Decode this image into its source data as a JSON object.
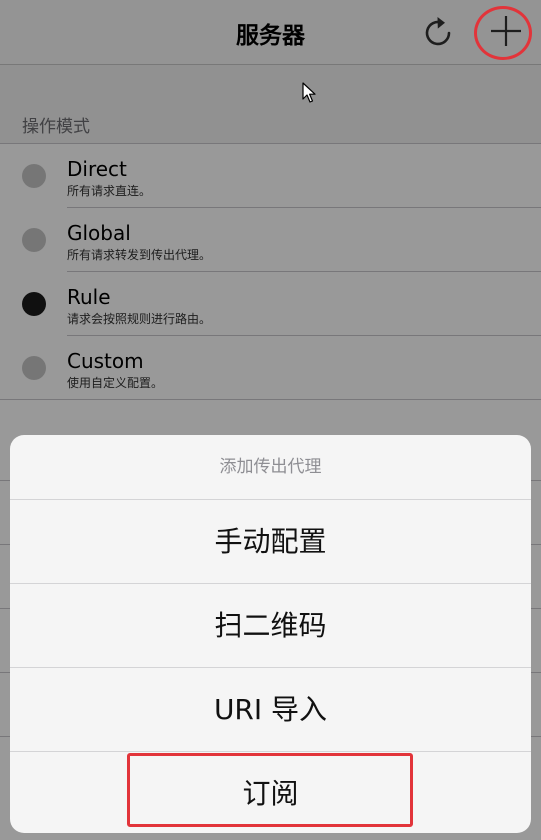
{
  "navbar": {
    "title": "服务器",
    "refresh_icon": "refresh-icon",
    "add_icon": "plus-icon"
  },
  "mode_section": {
    "header": "操作模式",
    "modes": [
      {
        "name": "Direct",
        "description": "所有请求直连。",
        "selected": false
      },
      {
        "name": "Global",
        "description": "所有请求转发到传出代理。",
        "selected": false
      },
      {
        "name": "Rule",
        "description": "请求会按照规则进行路由。",
        "selected": true
      },
      {
        "name": "Custom",
        "description": "使用自定义配置。",
        "selected": false
      }
    ]
  },
  "action_sheet": {
    "title": "添加传出代理",
    "actions": [
      {
        "label": "手动配置"
      },
      {
        "label": "扫二维码"
      },
      {
        "label": "URI 导入"
      },
      {
        "label": "订阅"
      }
    ]
  },
  "colors": {
    "highlight": "#e2343a",
    "selected_radio": "#1c1c1c",
    "unselected_radio": "#c5c5c5"
  }
}
